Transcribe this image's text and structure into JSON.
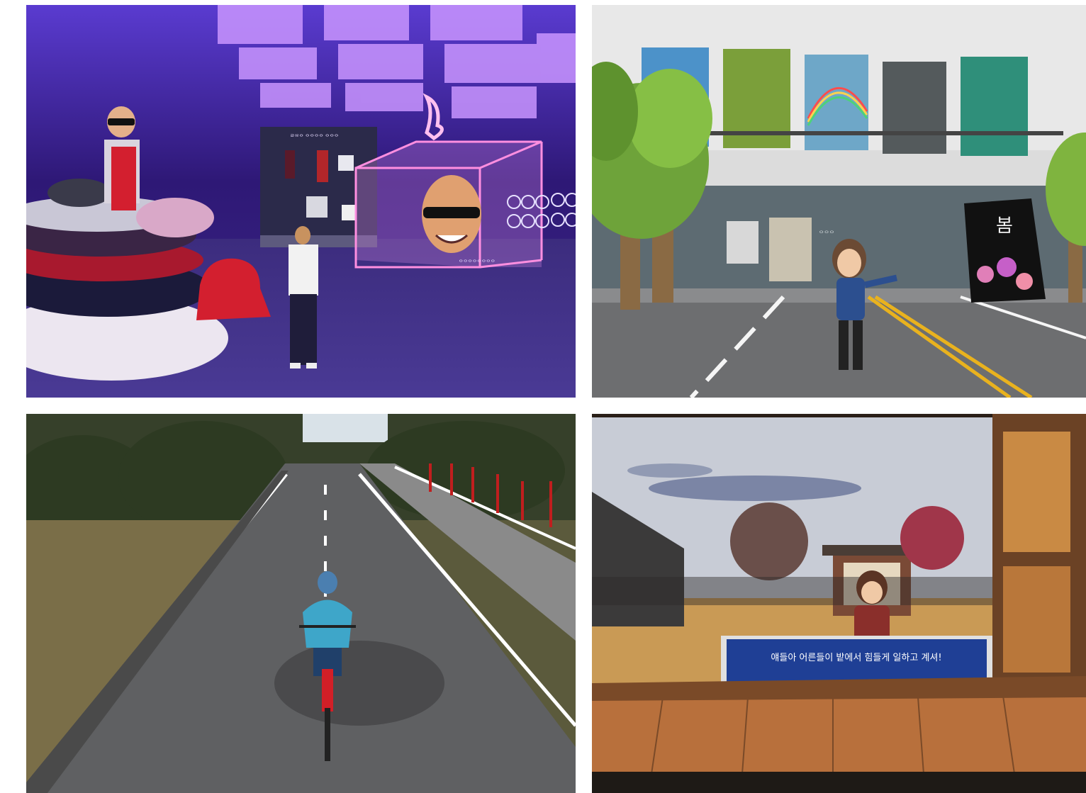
{
  "panels": {
    "virtual_store": {
      "board_title": "ᄅᄋᄅᄋ ᄋᄋᄋᄋ ᄋᄋᄋ",
      "cube_caption": "ᄋᄋᄋᄋᄋᄋᄋᄋ"
    },
    "gallery_street": {
      "poster_text": "봄",
      "wall_sign": "ᄋᄋᄋ"
    },
    "cycling_road": {},
    "village_scene": {
      "subtitle": "얘들아 어른들이 밭에서 힘들게 일하고 계셔!"
    }
  },
  "colors": {
    "store_purple": "#3a1f8c",
    "neon_pink": "#ff7fd6",
    "subtitle_blue": "#1f3f95",
    "road_gray": "#6d6e70"
  }
}
